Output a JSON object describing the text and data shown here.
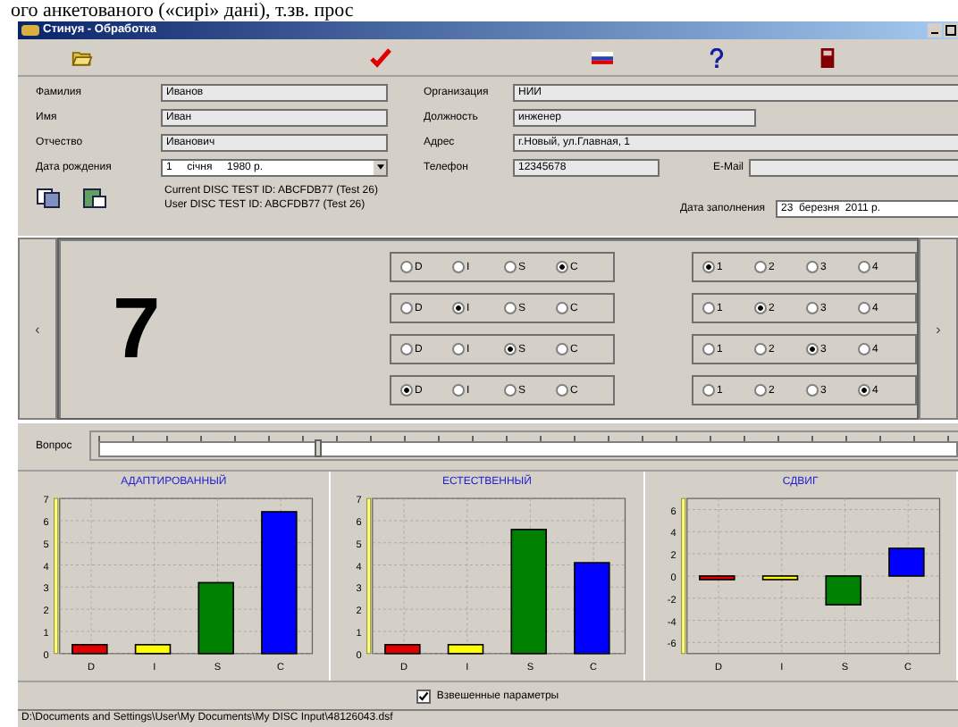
{
  "document_text": "ого анкетованого («сирі» дані), т.зв. прос",
  "window": {
    "title": "Стинуя - Обработка"
  },
  "left_fields": [
    {
      "label": "Фамилия",
      "value": "Иванов",
      "kind": "text"
    },
    {
      "label": "Имя",
      "value": "Иван",
      "kind": "text"
    },
    {
      "label": "Отчество",
      "value": "Иванович",
      "kind": "text"
    },
    {
      "label": "Дата рождения",
      "value": "1     січня     1980 р.",
      "kind": "dropdown"
    }
  ],
  "right_fields": [
    {
      "label": "Организация",
      "value": "НИИ",
      "kind": "wide"
    },
    {
      "label": "Должность",
      "value": "инженер",
      "kind": "medium"
    },
    {
      "label": "Адрес",
      "value": "г.Новый, ул.Главная, 1",
      "kind": "wide"
    },
    {
      "label": "Телефон",
      "value": "12345678",
      "kind": "phone"
    }
  ],
  "email": {
    "label": "E-Mail"
  },
  "test_ids": [
    "Current DISC TEST ID: ABCFDB77 (Test 26)",
    "User DISC TEST ID: ABCFDB77 (Test 26)"
  ],
  "fill_date": {
    "label": "Дата заполнения",
    "value": "23  березня  2011 р."
  },
  "question": {
    "number": "7",
    "prev": "‹",
    "next": "›",
    "rows": [
      {
        "disc": [
          {
            "label": "D",
            "selected": false
          },
          {
            "label": "I",
            "selected": false
          },
          {
            "label": "S",
            "selected": false
          },
          {
            "label": "C",
            "selected": true
          }
        ],
        "rank": [
          {
            "label": "1",
            "selected": true
          },
          {
            "label": "2",
            "selected": false
          },
          {
            "label": "3",
            "selected": false
          },
          {
            "label": "4",
            "selected": false
          }
        ]
      },
      {
        "disc": [
          {
            "label": "D",
            "selected": false
          },
          {
            "label": "I",
            "selected": true
          },
          {
            "label": "S",
            "selected": false
          },
          {
            "label": "C",
            "selected": false
          }
        ],
        "rank": [
          {
            "label": "1",
            "selected": false
          },
          {
            "label": "2",
            "selected": true
          },
          {
            "label": "3",
            "selected": false
          },
          {
            "label": "4",
            "selected": false
          }
        ]
      },
      {
        "disc": [
          {
            "label": "D",
            "selected": false
          },
          {
            "label": "I",
            "selected": false
          },
          {
            "label": "S",
            "selected": true
          },
          {
            "label": "C",
            "selected": false
          }
        ],
        "rank": [
          {
            "label": "1",
            "selected": false
          },
          {
            "label": "2",
            "selected": false
          },
          {
            "label": "3",
            "selected": true
          },
          {
            "label": "4",
            "selected": false
          }
        ]
      },
      {
        "disc": [
          {
            "label": "D",
            "selected": true
          },
          {
            "label": "I",
            "selected": false
          },
          {
            "label": "S",
            "selected": false
          },
          {
            "label": "C",
            "selected": false
          }
        ],
        "rank": [
          {
            "label": "1",
            "selected": false
          },
          {
            "label": "2",
            "selected": false
          },
          {
            "label": "3",
            "selected": false
          },
          {
            "label": "4",
            "selected": true
          }
        ]
      }
    ]
  },
  "slider": {
    "label": "Вопрос",
    "level": 0.25
  },
  "charts": [
    {
      "chart_data": {
        "type": "bar",
        "title": "АДАПТИРОВАННЫЙ",
        "categories": [
          "D",
          "I",
          "S",
          "C"
        ],
        "series": [
          {
            "values": [
              0.4,
              0.4,
              3.2,
              6.4
            ]
          }
        ],
        "grid": true,
        "colors": [
          "#e00000",
          "#ffff00",
          "#008000",
          "#0000ff"
        ],
        "ylim": [
          0,
          7
        ],
        "yticks": [
          0,
          1,
          2,
          3,
          4,
          5,
          6,
          7
        ]
      }
    },
    {
      "chart_data": {
        "type": "bar",
        "title": "ЕСТЕСТВЕННЫЙ",
        "categories": [
          "D",
          "I",
          "S",
          "C"
        ],
        "series": [
          {
            "values": [
              0.4,
              0.4,
              5.6,
              4.1
            ]
          }
        ],
        "grid": true,
        "colors": [
          "#e00000",
          "#ffff00",
          "#008000",
          "#0000ff"
        ],
        "ylim": [
          0,
          7
        ],
        "yticks": [
          0,
          1,
          2,
          3,
          4,
          5,
          6,
          7
        ]
      }
    },
    {
      "chart_data": {
        "type": "bar",
        "title": "СДВИГ",
        "categories": [
          "D",
          "I",
          "S",
          "C"
        ],
        "series": [
          {
            "values": [
              0,
              0,
              -2.6,
              2.5
            ]
          }
        ],
        "grid": true,
        "colors": [
          "#e00000",
          "#ffff00",
          "#008000",
          "#0000ff"
        ],
        "ylim": [
          -7,
          7
        ],
        "yticks": [
          -6,
          -4,
          -2,
          0,
          2,
          4,
          6
        ]
      }
    }
  ],
  "weighted": {
    "label": "Взвешенные параметры",
    "checked": true
  },
  "status_bar": "D:\\Documents and Settings\\User\\My Documents\\My DISC Input\\48126043.dsf"
}
